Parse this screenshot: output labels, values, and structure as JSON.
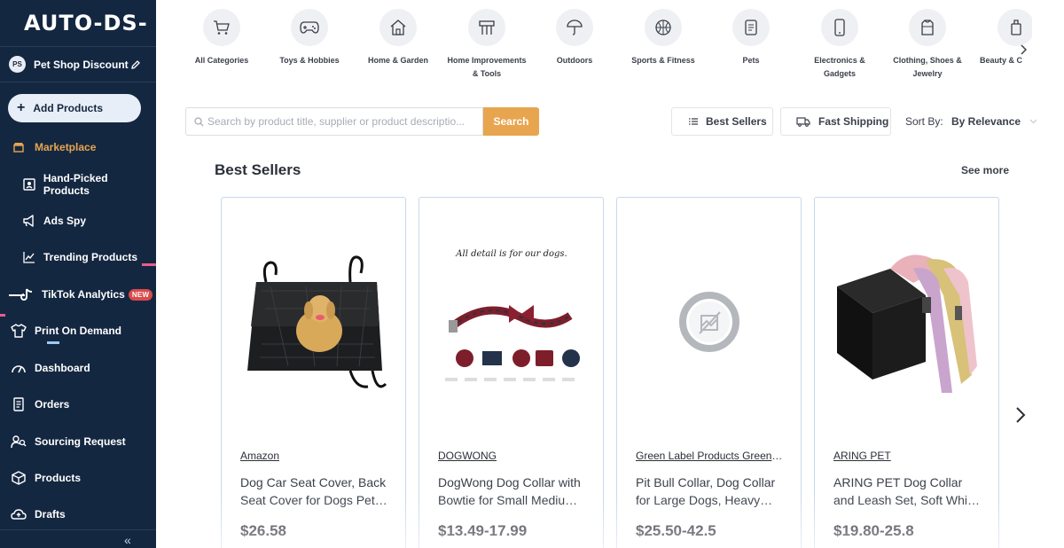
{
  "app": {
    "logo_text": "AUTO-DS-"
  },
  "store": {
    "initials": "PS",
    "name": "Pet Shop Discount"
  },
  "sidebar": {
    "add_products_label": "Add Products",
    "items": [
      {
        "label": "Marketplace",
        "icon": "store-icon"
      },
      {
        "label": "Hand-Picked Products",
        "icon": "hand-picked-icon"
      },
      {
        "label": "Ads Spy",
        "icon": "megaphone-icon"
      },
      {
        "label": "Trending Products",
        "icon": "trending-icon"
      },
      {
        "label": "TikTok Analytics",
        "icon": "tiktok-icon",
        "badge": "NEW"
      },
      {
        "label": "Print On Demand",
        "icon": "shirt-icon"
      },
      {
        "label": "Dashboard",
        "icon": "dashboard-icon"
      },
      {
        "label": "Orders",
        "icon": "orders-icon"
      },
      {
        "label": "Sourcing Request",
        "icon": "sourcing-icon"
      },
      {
        "label": "Products",
        "icon": "box-icon"
      },
      {
        "label": "Drafts",
        "icon": "drafts-icon"
      }
    ],
    "collapse_glyph": "«"
  },
  "categories": [
    {
      "label": "All Categories",
      "icon": "cart-icon"
    },
    {
      "label": "Toys & Hobbies",
      "icon": "gamepad-icon"
    },
    {
      "label": "Home & Garden",
      "icon": "house-icon"
    },
    {
      "label": "Home Improvements & Tools",
      "icon": "tools-icon"
    },
    {
      "label": "Outdoors",
      "icon": "umbrella-icon"
    },
    {
      "label": "Sports & Fitness",
      "icon": "ball-icon"
    },
    {
      "label": "Pets",
      "icon": "pet-icon"
    },
    {
      "label": "Electronics & Gadgets",
      "icon": "phone-icon"
    },
    {
      "label": "Clothing, Shoes & Jewelry",
      "icon": "shirt-icon"
    },
    {
      "label": "Beauty & C",
      "icon": "beauty-icon"
    }
  ],
  "search": {
    "placeholder": "Search by product title, supplier or product descriptio...",
    "value": "",
    "button_label": "Search"
  },
  "filters": {
    "best_sellers_label": "Best Sellers",
    "fast_shipping_label": "Fast Shipping",
    "sort_label": "Sort By:",
    "sort_value": "By Relevance"
  },
  "section": {
    "title": "Best Sellers",
    "see_more_label": "See more"
  },
  "products": [
    {
      "brand": "Amazon",
      "title": "Dog Car Seat Cover, Back Seat Cover for Dogs Pet Car Seat Protector",
      "price": "$26.58",
      "image": "seat-cover-image",
      "image_caption": ""
    },
    {
      "brand": "DOGWONG",
      "title": "DogWong Dog Collar with Bowtie for Small Medium Large Dogs",
      "price": "$13.49-17.99",
      "image": "dog-collar-image",
      "image_caption": "All detail is for our dogs."
    },
    {
      "brand": "Green Label Products Green Label",
      "title": "Pit Bull Collar, Dog Collar for Large Dogs, Heavy Duty Dog Collar",
      "price": "$25.50-42.5",
      "image": "no-image-placeholder",
      "image_caption": ""
    },
    {
      "brand": "ARING PET",
      "title": "ARING PET Dog Collar and Leash Set, Soft White Velvet Dog Collar",
      "price": "$19.80-25.8",
      "image": "collar-set-image",
      "image_caption": ""
    }
  ],
  "colors": {
    "sidebar_bg": "#142741",
    "accent": "#e8a54f",
    "badge": "#d94a4a",
    "card_border": "#c9d8ec"
  }
}
